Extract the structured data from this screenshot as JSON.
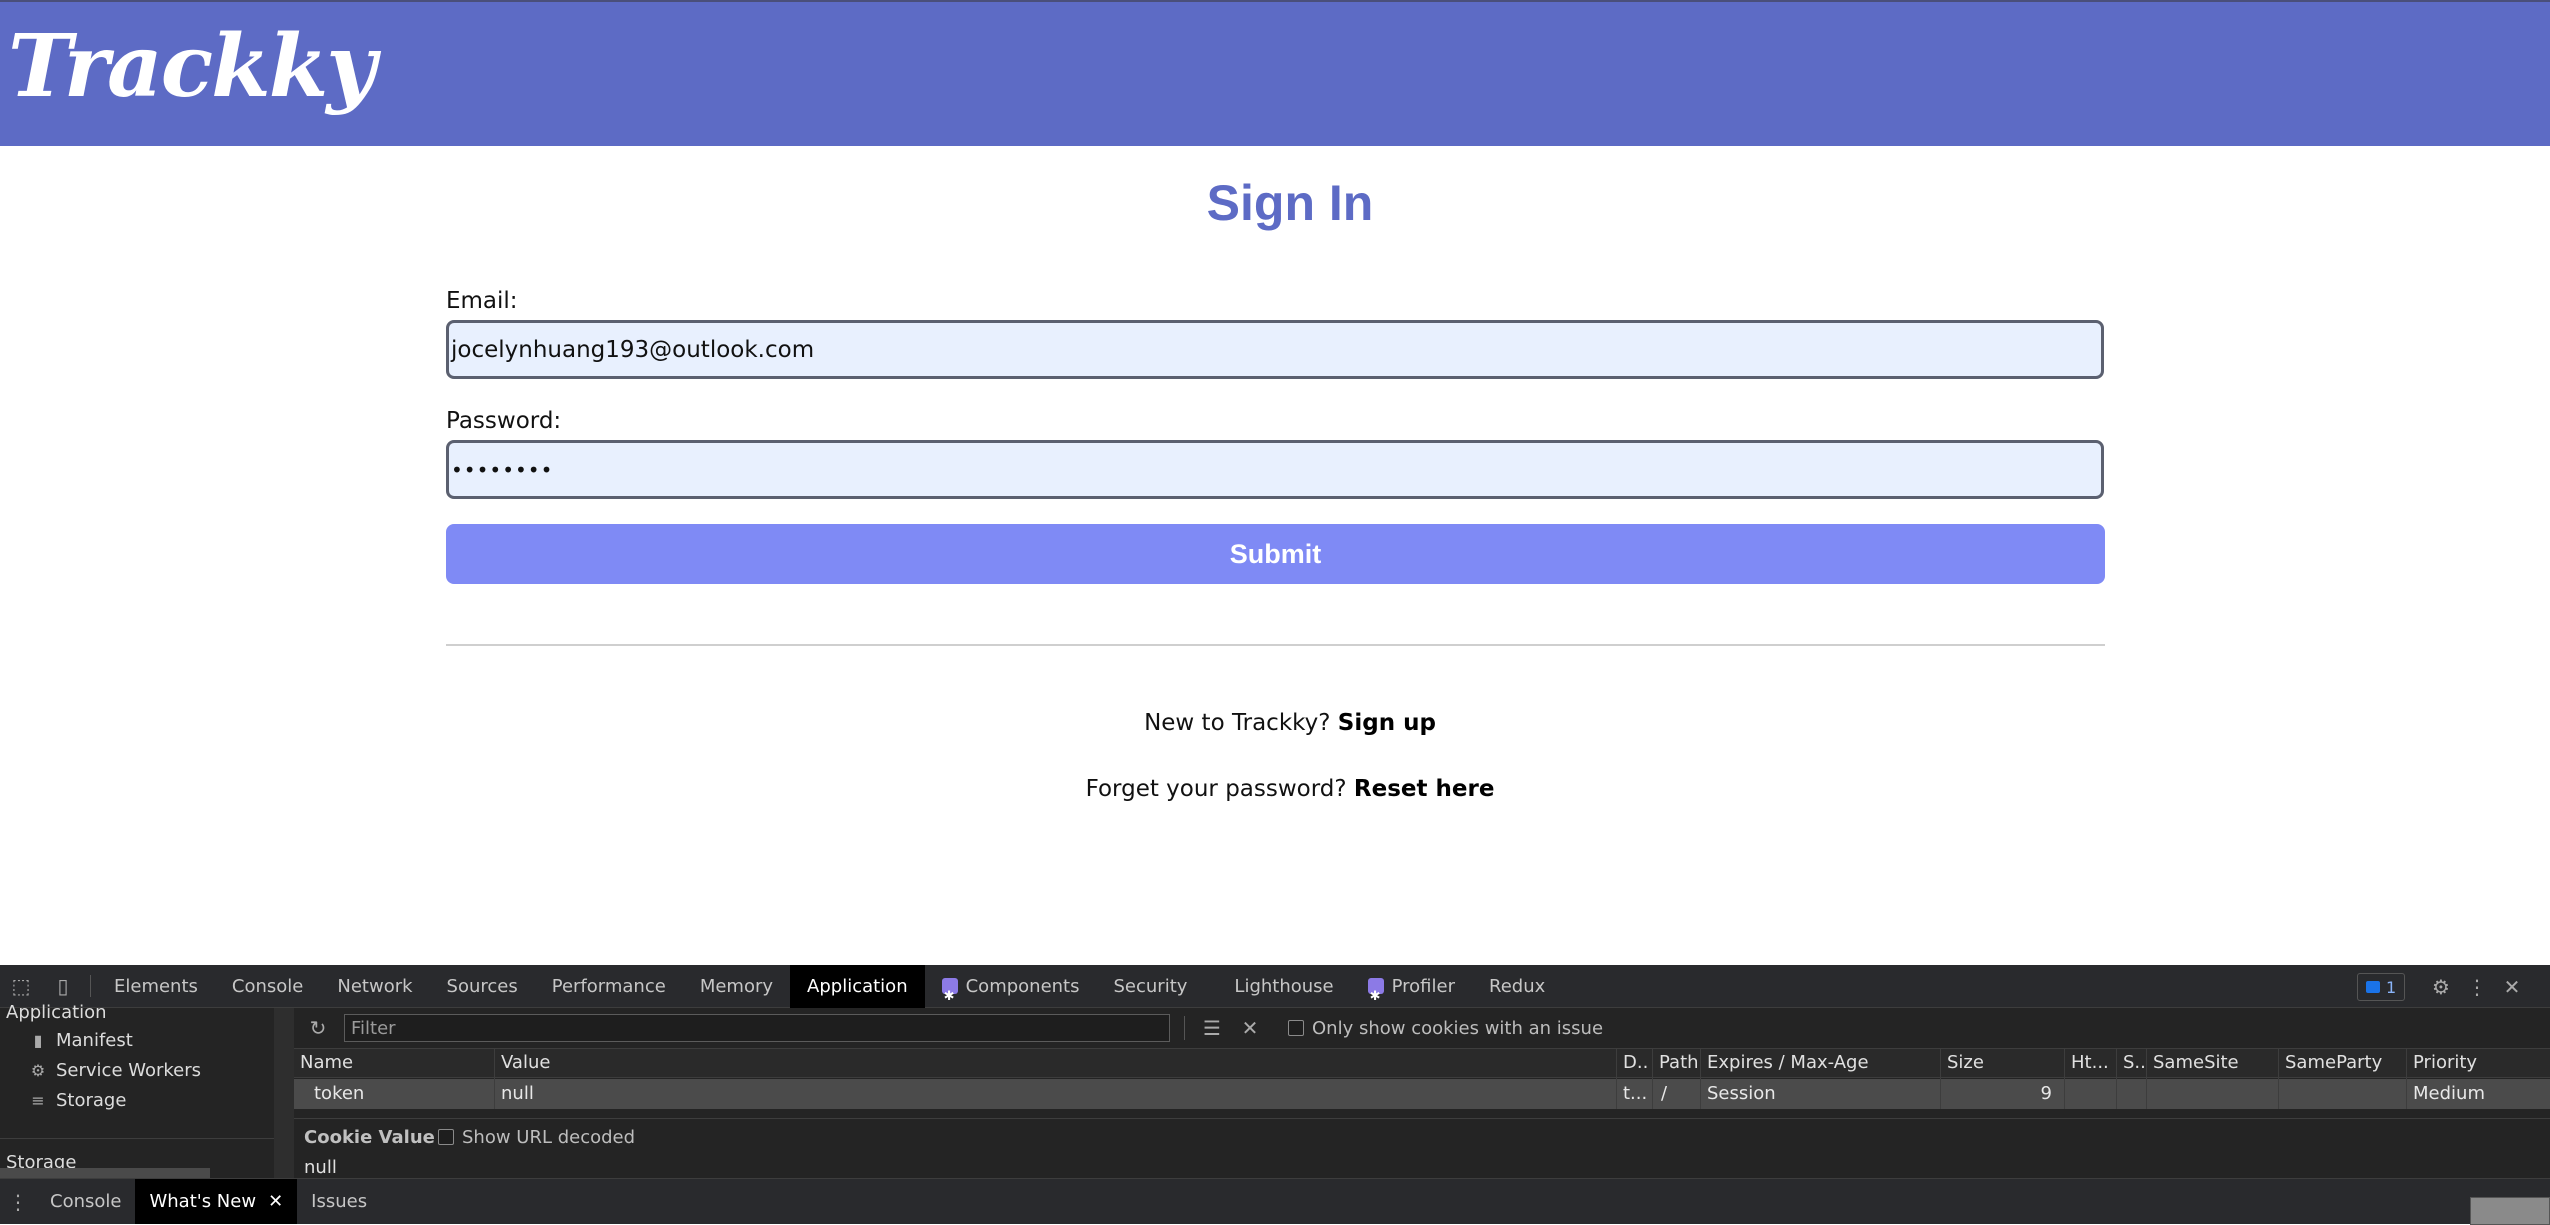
{
  "app": {
    "logo": "Trackky",
    "title": "Sign In",
    "email_label": "Email:",
    "email_value": "jocelynhuang193@outlook.com",
    "password_label": "Password:",
    "password_value": "••••••••",
    "submit_label": "Submit",
    "signup_prompt": "New to Trackky?",
    "signup_link": "Sign up",
    "reset_prompt": "Forget your password?",
    "reset_link": "Reset here",
    "colors": {
      "header": "#5d6bc5",
      "title": "#5d6bc5",
      "button": "#7f8af5",
      "field_bg": "#e8f0fe"
    }
  },
  "devtools": {
    "tabs": [
      "Elements",
      "Console",
      "Network",
      "Sources",
      "Performance",
      "Memory",
      "Application",
      "Components",
      "Security",
      "Lighthouse",
      "Profiler",
      "Redux"
    ],
    "active_tab": "Application",
    "issues_count": "1",
    "sidebar": {
      "section_application": "Application",
      "items": [
        "Manifest",
        "Service Workers",
        "Storage"
      ],
      "section_storage": "Storage"
    },
    "filter_placeholder": "Filter",
    "only_issue_label": "Only show cookies with an issue",
    "columns": [
      "Name",
      "Value",
      "D..",
      "Path",
      "Expires / Max-Age",
      "Size",
      "Ht...",
      "S..",
      "SameSite",
      "SameParty",
      "Priority"
    ],
    "rows": [
      {
        "name": "token",
        "value": "null",
        "domain": "t...",
        "path": "/",
        "expires": "Session",
        "size": "9",
        "priority": "Medium"
      }
    ],
    "cookie_value_label": "Cookie Value",
    "show_url_decoded_label": "Show URL decoded",
    "cookie_value": "null",
    "drawer_tabs": [
      "Console",
      "What's New",
      "Issues"
    ],
    "drawer_active": "What's New"
  }
}
